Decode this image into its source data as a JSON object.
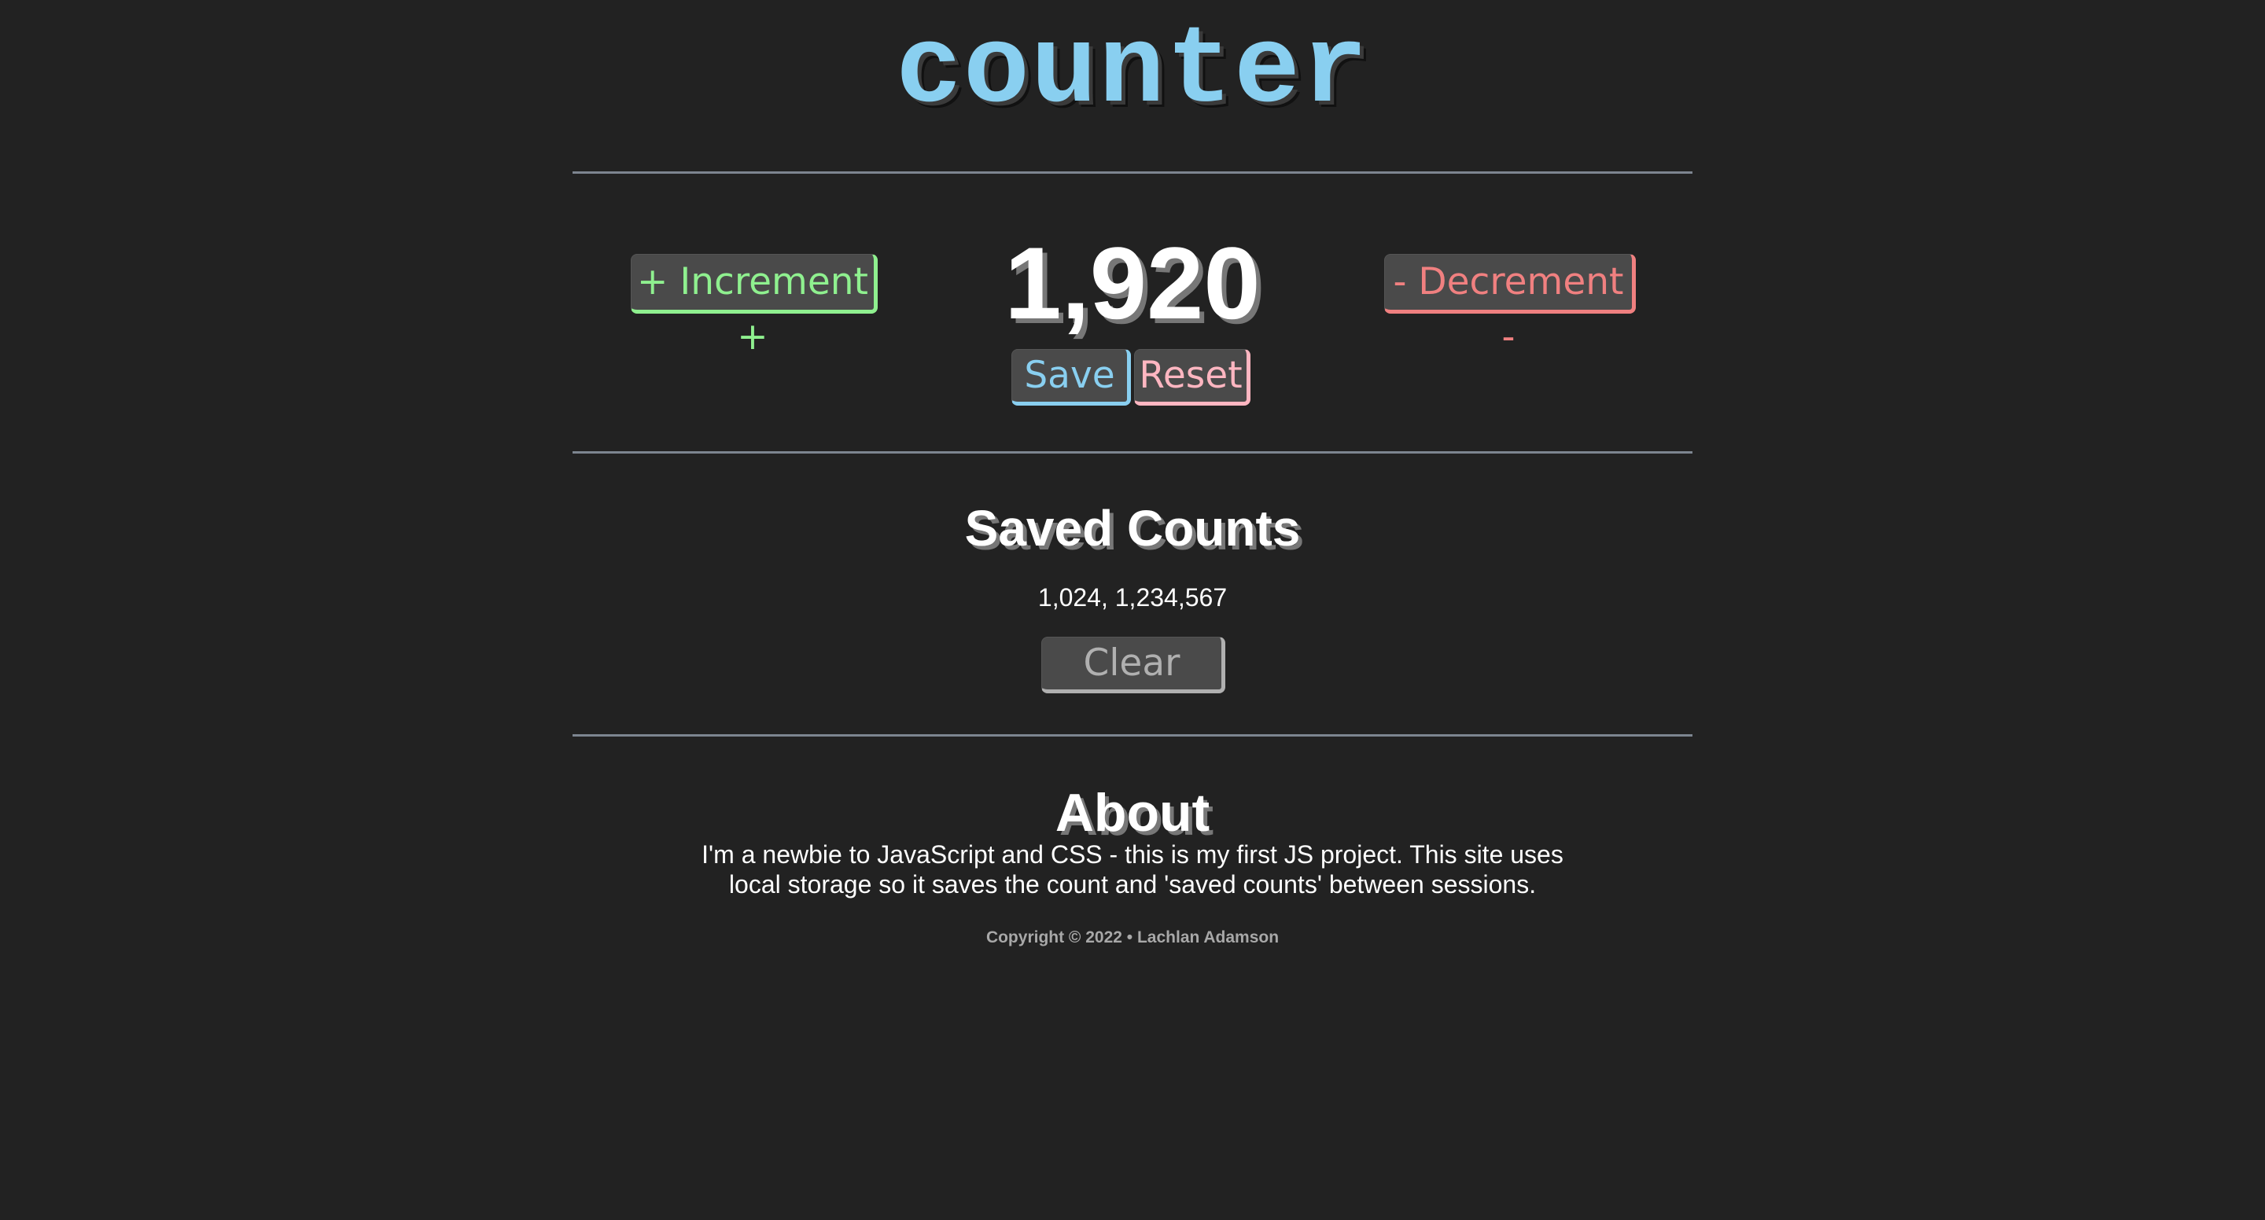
{
  "app": {
    "title": "counter"
  },
  "counter": {
    "increment_label": "+ Increment +",
    "decrement_label": "- Decrement -",
    "value": "1,920",
    "save_label": "Save",
    "reset_label": "Reset"
  },
  "saved": {
    "heading": "Saved Counts",
    "list_text": "1,024, 1,234,567",
    "clear_label": "Clear"
  },
  "about": {
    "heading": "About",
    "text": "I'm a newbie to JavaScript and CSS - this is my first JS project. This site uses local storage so it saves the count and 'saved counts' between sessions."
  },
  "footer": {
    "text": "Copyright © 2022 • Lachlan Adamson"
  },
  "colors": {
    "background": "#222222",
    "title": "#89cff0",
    "increment": "#8ff08f",
    "decrement": "#f08080",
    "save": "#89cff0",
    "reset": "#ffb6c1",
    "clear": "#b0b0b0",
    "rule": "#7d8590"
  }
}
